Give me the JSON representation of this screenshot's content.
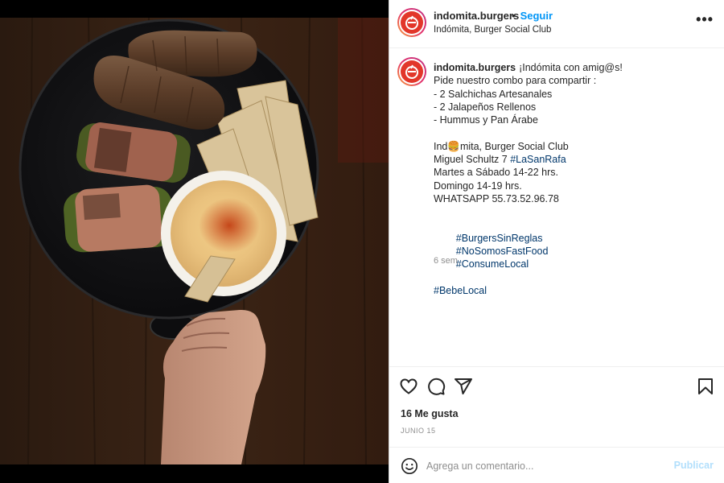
{
  "header": {
    "username": "indomita.burgers",
    "separator": "•",
    "follow_label": "Seguir",
    "location": "Indómita, Burger Social Club",
    "more_icon": "more-options-icon",
    "more_label": "•••"
  },
  "caption": {
    "username": "indomita.burgers",
    "lines": [
      "¡Indómita con amig@s!",
      "Pide nuestro combo para compartir :",
      "- 2 Salchichas Artesanales",
      "- 2 Jalapeños Rellenos",
      "- Hummus y Pan Árabe",
      "",
      "Ind🍔mita, Burger Social Club",
      "Miguel Schultz 7 ",
      "Martes a Sábado 14-22 hrs.",
      "Domingo 14-19 hrs.",
      "WHATSAPP 55.73.52.96.78",
      ""
    ],
    "location_tag": "#LaSanRafa",
    "hashtags_line1": [
      "#BurgersSinReglas",
      "#NoSomosFastFood",
      "#ConsumeLocal"
    ],
    "hashtags_line2": [
      "#BebeLocal"
    ],
    "time_ago": "6 sem"
  },
  "actions": {
    "icons": [
      "heart-icon",
      "comment-icon",
      "share-icon",
      "bookmark-icon"
    ],
    "likes": "16 Me gusta",
    "date": "JUNIO 15"
  },
  "comment": {
    "placeholder": "Agrega un comentario...",
    "post_label": "Publicar",
    "emoji_icon": "emoji-icon"
  },
  "colors": {
    "link": "#0095f6",
    "hashtag": "#00376b",
    "muted": "#8e8e8e",
    "brand_red": "#e2362a"
  }
}
